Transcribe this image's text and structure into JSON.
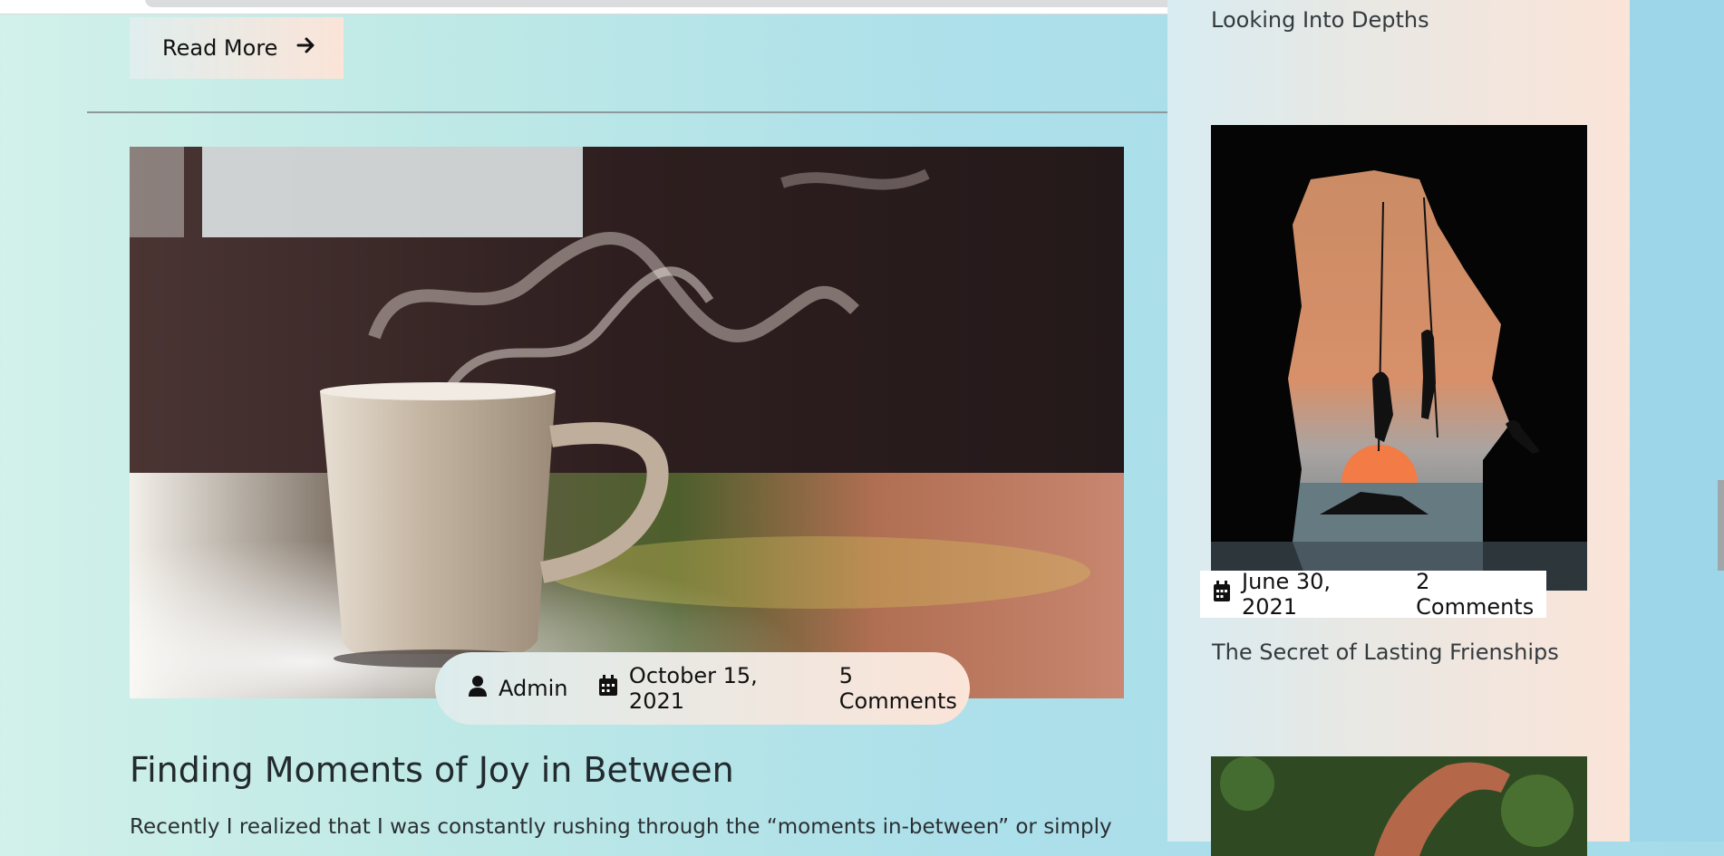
{
  "read_more": {
    "label": "Read More",
    "icon": "arrow-right-icon"
  },
  "post": {
    "author": "Admin",
    "date": "October 15, 2021",
    "comments": "5 Comments",
    "title": "Finding Moments of Joy in Between",
    "excerpt": "Recently I realized that I was constantly rushing through the “moments in-between” or simply"
  },
  "sidebar": {
    "prev_title": "Looking Into Depths",
    "card": {
      "date": "June 30, 2021",
      "comments": "2 Comments",
      "title": "The Secret of Lasting Frienships"
    }
  },
  "colors": {
    "bg_start": "#d2f1ea",
    "bg_end": "#a6dbea",
    "accent_warm": "#fbe4d8"
  }
}
